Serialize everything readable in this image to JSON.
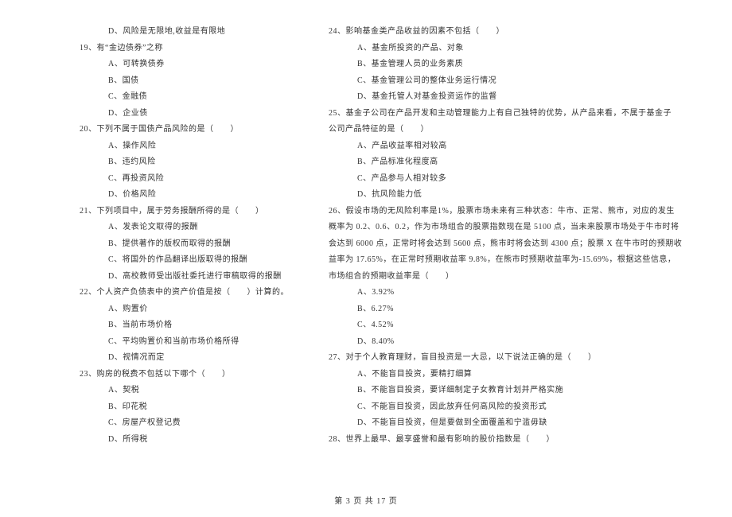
{
  "left": [
    {
      "indent": 2,
      "text": "D、风险是无限地,收益是有限地"
    },
    {
      "indent": 1,
      "text": "19、有“金边债券”之称"
    },
    {
      "indent": 2,
      "text": "A、可转换债券"
    },
    {
      "indent": 2,
      "text": "B、国债"
    },
    {
      "indent": 2,
      "text": "C、金融债"
    },
    {
      "indent": 2,
      "text": "D、企业债"
    },
    {
      "indent": 1,
      "text": "20、下列不属于国债产品风险的是（　　）"
    },
    {
      "indent": 2,
      "text": "A、操作风险"
    },
    {
      "indent": 2,
      "text": "B、违约风险"
    },
    {
      "indent": 2,
      "text": "C、再投资风险"
    },
    {
      "indent": 2,
      "text": "D、价格风险"
    },
    {
      "indent": 1,
      "text": "21、下列项目中，属于劳务报酬所得的是（　　）"
    },
    {
      "indent": 2,
      "text": "A、发表论文取得的报酬"
    },
    {
      "indent": 2,
      "text": "B、提供著作的版权而取得的报酬"
    },
    {
      "indent": 2,
      "text": "C、将国外的作品翻译出版取得的报酬"
    },
    {
      "indent": 2,
      "text": "D、高校教师受出版社委托进行审稿取得的报酬"
    },
    {
      "indent": 1,
      "text": "22、个人资产负债表中的资产价值是按（　　）计算的。"
    },
    {
      "indent": 2,
      "text": "A、购置价"
    },
    {
      "indent": 2,
      "text": "B、当前市场价格"
    },
    {
      "indent": 2,
      "text": "C、平均购置价和当前市场价格所得"
    },
    {
      "indent": 2,
      "text": "D、视情况而定"
    },
    {
      "indent": 1,
      "text": "23、购房的税费不包括以下哪个（　　）"
    },
    {
      "indent": 2,
      "text": "A、契税"
    },
    {
      "indent": 2,
      "text": "B、印花税"
    },
    {
      "indent": 2,
      "text": "C、房屋产权登记费"
    },
    {
      "indent": 2,
      "text": "D、所得税"
    }
  ],
  "right": [
    {
      "indent": 1,
      "text": "24、影响基金类产品收益的因素不包括（　　）"
    },
    {
      "indent": 2,
      "text": "A、基金所投资的产品、对象"
    },
    {
      "indent": 2,
      "text": "B、基金管理人员的业务素质"
    },
    {
      "indent": 2,
      "text": "C、基金管理公司的整体业务运行情况"
    },
    {
      "indent": 2,
      "text": "D、基金托管人对基金投资运作的监督"
    },
    {
      "indent": 1,
      "text": "25、基金子公司在产品开发和主动管理能力上有自己独特的优势，从产品来看，不属于基金子"
    },
    {
      "indent": 1,
      "text": "公司产品特征的是（　　）"
    },
    {
      "indent": 2,
      "text": "A、产品收益率相对较高"
    },
    {
      "indent": 2,
      "text": "B、产品标准化程度高"
    },
    {
      "indent": 2,
      "text": "C、产品参与人相对较多"
    },
    {
      "indent": 2,
      "text": "D、抗风险能力低"
    },
    {
      "indent": 1,
      "text": "26、假设市场的无风险利率是1%，股票市场未来有三种状态：牛市、正常、熊市，对应的发生"
    },
    {
      "indent": 1,
      "text": "概率为 0.2、0.6、0.2，作为市场组合的股票指数现在是 5100 点，当未来股票市场处于牛市时将"
    },
    {
      "indent": 1,
      "text": "会达到 6000 点，正常时将会达到 5600 点，熊市时将会达到 4300 点；股票 X 在牛市时的预期收"
    },
    {
      "indent": 1,
      "text": "益率为 17.65%，在正常时预期收益率 9.8%，在熊市时预期收益率为-15.69%，根据这些信息，"
    },
    {
      "indent": 1,
      "text": "市场组合的预期收益率是（　　）"
    },
    {
      "indent": 2,
      "text": "A、3.92%"
    },
    {
      "indent": 2,
      "text": "B、6.27%"
    },
    {
      "indent": 2,
      "text": "C、4.52%"
    },
    {
      "indent": 2,
      "text": "D、8.40%"
    },
    {
      "indent": 1,
      "text": "27、对于个人教育理财，盲目投资是一大忌，以下说法正确的是（　　）"
    },
    {
      "indent": 2,
      "text": "A、不能盲目投资，要精打细算"
    },
    {
      "indent": 2,
      "text": "B、不能盲目投资，要详细制定子女教育计划并严格实施"
    },
    {
      "indent": 2,
      "text": "C、不能盲目投资，因此放弃任何高风险的投资形式"
    },
    {
      "indent": 2,
      "text": "D、不能盲目投资，但是要做到全面覆盖和宁滥毋缺"
    },
    {
      "indent": 1,
      "text": "28、世界上最早、最享盛誉和最有影响的股价指数是（　　）"
    }
  ],
  "footer": "第 3 页 共 17 页"
}
